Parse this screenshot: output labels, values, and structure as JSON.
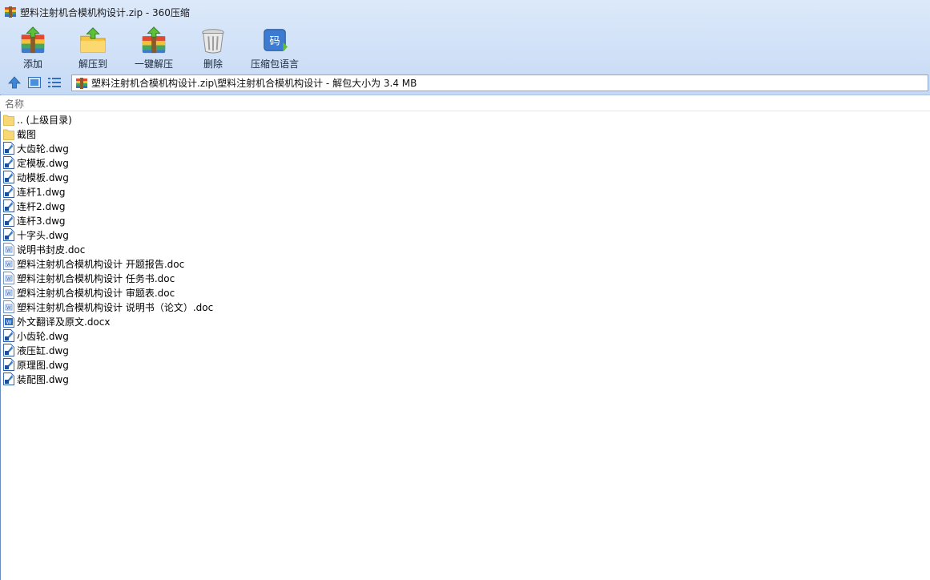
{
  "window": {
    "title": "塑料注射机合模机构设计.zip - 360压缩"
  },
  "toolbar": {
    "buttons": [
      {
        "label": "添加",
        "icon": "add-archive-icon"
      },
      {
        "label": "解压到",
        "icon": "extract-to-icon"
      },
      {
        "label": "一键解压",
        "icon": "one-click-extract-icon"
      },
      {
        "label": "删除",
        "icon": "delete-icon"
      },
      {
        "label": "压缩包语言",
        "icon": "archive-encoding-icon",
        "glyph": "码"
      }
    ]
  },
  "nav": {
    "address": "塑料注射机合模机构设计.zip\\塑料注射机合模机构设计 - 解包大小为 3.4 MB"
  },
  "list": {
    "column_name": "名称",
    "items": [
      {
        "name": ".. (上级目录)",
        "type": "folder"
      },
      {
        "name": "截图",
        "type": "folder"
      },
      {
        "name": "大齿轮.dwg",
        "type": "dwg"
      },
      {
        "name": "定模板.dwg",
        "type": "dwg"
      },
      {
        "name": "动模板.dwg",
        "type": "dwg"
      },
      {
        "name": "连杆1.dwg",
        "type": "dwg"
      },
      {
        "name": "连杆2.dwg",
        "type": "dwg"
      },
      {
        "name": "连杆3.dwg",
        "type": "dwg"
      },
      {
        "name": "十字头.dwg",
        "type": "dwg"
      },
      {
        "name": "说明书封皮.doc",
        "type": "doc"
      },
      {
        "name": "塑料注射机合模机构设计 开题报告.doc",
        "type": "doc"
      },
      {
        "name": "塑料注射机合模机构设计 任务书.doc",
        "type": "doc"
      },
      {
        "name": "塑料注射机合模机构设计 审题表.doc",
        "type": "doc"
      },
      {
        "name": "塑料注射机合模机构设计 说明书（论文）.doc",
        "type": "doc"
      },
      {
        "name": "外文翻译及原文.docx",
        "type": "docx"
      },
      {
        "name": "小齿轮.dwg",
        "type": "dwg"
      },
      {
        "name": "液压缸.dwg",
        "type": "dwg"
      },
      {
        "name": "原理图.dwg",
        "type": "dwg"
      },
      {
        "name": "装配图.dwg",
        "type": "dwg"
      }
    ]
  }
}
